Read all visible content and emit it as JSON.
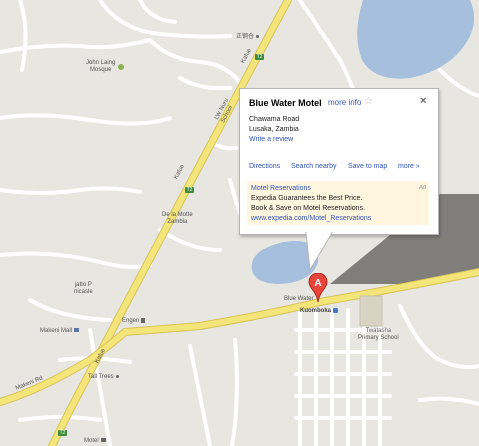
{
  "map": {
    "roads": {
      "kafue": "Kafue",
      "makeni_rd": "Makeni Rd",
      "shield_t2": "T2"
    },
    "places": {
      "chinese_label": "正钢仓",
      "john_laing_mosque": "John Laing\nMosque",
      "lw_nuru_school": "LW Nuru\nSchool",
      "de_la_motte": "De la Motte\nZambia",
      "jatto_p": "jatto P\nnicasle",
      "makeni_mall": "Makeni Mall",
      "engen": "Engen",
      "tall_trees": "Tall Trees",
      "motel_bottom": "Motel",
      "blue_water_label": "Blue Water",
      "kuomboka": "Kuomboka",
      "twatasha": "Twatasha\nPrimary School"
    },
    "marker_letter": "A"
  },
  "info": {
    "title": "Blue Water Motel",
    "more_info": "more info",
    "address_line1": "Chawama Road",
    "address_line2": "Lusaka, Zambia",
    "write_review": "Write a review",
    "actions": [
      "Directions",
      "Search nearby",
      "Save to map",
      "more »"
    ],
    "ad": {
      "title": "Motel Reservations",
      "tag": "Ad",
      "line1": "Expedia Guarantees the Best Price.",
      "line2": "Book & Save on Motel Reservations.",
      "url": "www.expedia.com/Motel_Reservations"
    }
  },
  "colors": {
    "background": "#e8e6e1",
    "water": "#a5bfdd",
    "road_major": "#f4e57a",
    "road_outline": "#d8c35a",
    "road_minor": "#ffffff",
    "link": "#3355bb",
    "marker": "#e8453c"
  }
}
